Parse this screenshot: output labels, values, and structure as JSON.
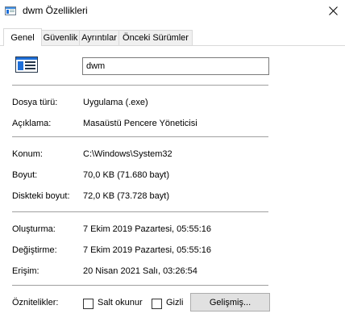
{
  "window": {
    "title": "dwm Özellikleri"
  },
  "tabs": [
    {
      "label": "Genel"
    },
    {
      "label": "Güvenlik"
    },
    {
      "label": "Ayrıntılar"
    },
    {
      "label": "Önceki Sürümler"
    }
  ],
  "general": {
    "file_name": "dwm",
    "fields": [
      {
        "label": "Dosya türü:",
        "value": "Uygulama (.exe)"
      },
      {
        "label": "Açıklama:",
        "value": "Masaüstü Pencere Yöneticisi"
      },
      {
        "label": "Konum:",
        "value": "C:\\Windows\\System32"
      },
      {
        "label": "Boyut:",
        "value": "70,0 KB (71.680 bayt)"
      },
      {
        "label": "Diskteki boyut:",
        "value": "72,0 KB (73.728 bayt)"
      },
      {
        "label": "Oluşturma:",
        "value": "7 Ekim 2019 Pazartesi, 05:55:16"
      },
      {
        "label": "Değiştirme:",
        "value": "7 Ekim 2019 Pazartesi, 05:55:16"
      },
      {
        "label": "Erişim:",
        "value": "20 Nisan 2021 Salı, 03:26:54"
      }
    ],
    "attributes": {
      "label": "Öznitelikler:",
      "readonly_label": "Salt okunur",
      "hidden_label": "Gizli",
      "advanced_button": "Gelişmiş..."
    }
  },
  "colors": {
    "icon_blue": "#1e6fd9",
    "icon_dark": "#26364a"
  }
}
